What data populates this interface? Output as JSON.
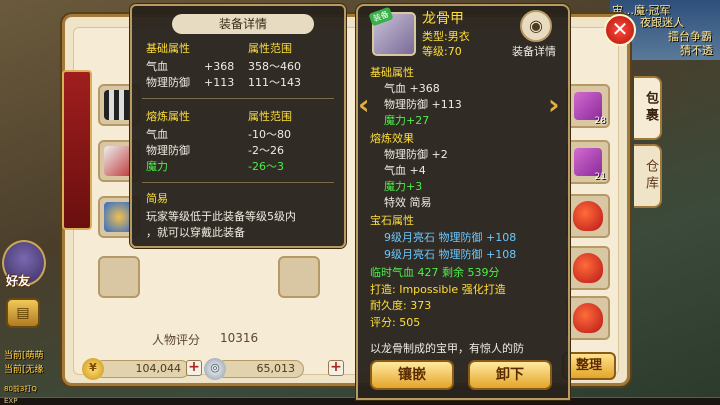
{
  "world": {
    "top_right_lines": [
      "宙…魔·冠军",
      "夜跟迷人",
      "擂台争霸",
      "猜不透"
    ],
    "friend_label": "好友",
    "status_lines": [
      "当前[萌萌",
      "当前[无缘",
      "80前3打Q"
    ],
    "exp_label": "EXP"
  },
  "main": {
    "score_label": "人物评分",
    "score_value": "10316",
    "gold": "104,044",
    "silver": "65,013",
    "arrange_label": "整理",
    "tabs": [
      "包裹",
      "仓库"
    ],
    "close_icon": "✕",
    "inventory_counts": [
      "28",
      "21"
    ]
  },
  "compare_tooltip": {
    "header": "装备详情",
    "base_title": "基础属性",
    "base_range_title": "属性范围",
    "base_attrs": [
      {
        "name": "气血",
        "value": "+368",
        "range": "358～460"
      },
      {
        "name": "物理防御",
        "value": "+113",
        "range": "111～143"
      }
    ],
    "refine_title": "熔炼属性",
    "refine_range_title": "属性范围",
    "refine_attrs": [
      {
        "name": "气血",
        "range": "-10～80"
      },
      {
        "name": "物理防御",
        "range": "-2～26"
      },
      {
        "name": "魔力",
        "range": "-26～3"
      }
    ],
    "special_title": "简易",
    "special_desc_1": "玩家等级低于此装备等级5级内",
    "special_desc_2": "，就可以穿戴此装备"
  },
  "item_tooltip": {
    "equipped_badge": "装备",
    "item_name": "龙骨甲",
    "item_type": "类型:男衣",
    "item_level": "等级:70",
    "detail_label": "装备详情",
    "base_title": "基础属性",
    "base_attrs": [
      "气血 +368",
      "物理防御 +113",
      "魔力+27"
    ],
    "refine_title": "熔炼效果",
    "refine_attrs": [
      "物理防御 +2",
      "气血 +4",
      "魔力+3",
      "特效 简易"
    ],
    "gem_title": "宝石属性",
    "gem_attrs": [
      "9级月亮石 物理防御 +108",
      "9级月亮石 物理防御 +108"
    ],
    "temp_hp": "临时气血 427 剩余 539分",
    "forge": "打造: Impossible 强化打造",
    "durability": "耐久度: 373",
    "rating": "评分: 505",
    "desc_cut": "以龙骨制成的宝甲，有惊人的防",
    "inlay_button": "镶嵌",
    "unequip_button": "卸下"
  },
  "colors": {
    "attr_title": "#ffdf3a",
    "attr_value": "#f0ece2",
    "magic": "#4af04a",
    "gem": "#6ac8ff"
  }
}
